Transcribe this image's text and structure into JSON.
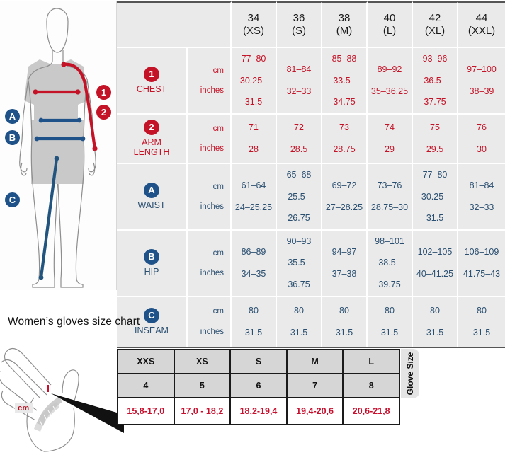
{
  "body_chart": {
    "header": {
      "corner_label": "",
      "sizes": [
        {
          "num": "34",
          "alpha": "(XS)"
        },
        {
          "num": "36",
          "alpha": "(S)"
        },
        {
          "num": "38",
          "alpha": "(M)"
        },
        {
          "num": "40",
          "alpha": "(L)"
        },
        {
          "num": "42",
          "alpha": "(XL)"
        },
        {
          "num": "44",
          "alpha": "(XXL)"
        }
      ]
    },
    "units": {
      "cm": "cm",
      "inches": "inches"
    },
    "rows": [
      {
        "badge": "1",
        "badge_color": "#c41226",
        "label": "CHEST",
        "color": "red",
        "cm": [
          "77–80",
          "81–84",
          "85–88",
          "89–92",
          "93–96",
          "97–100"
        ],
        "inches": [
          "30.25–31.5",
          "32–33",
          "33.5–34.75",
          "35–36.25",
          "36.5–37.75",
          "38–39"
        ]
      },
      {
        "badge": "2",
        "badge_color": "#c41226",
        "label": "ARM LENGTH",
        "color": "red",
        "cm": [
          "71",
          "72",
          "73",
          "74",
          "75",
          "76"
        ],
        "inches": [
          "28",
          "28.5",
          "28.75",
          "29",
          "29.5",
          "30"
        ]
      },
      {
        "badge": "A",
        "badge_color": "#1f5288",
        "label": "WAIST",
        "color": "blue",
        "cm": [
          "61–64",
          "65–68",
          "69–72",
          "73–76",
          "77–80",
          "81–84"
        ],
        "inches": [
          "24–25.25",
          "25.5–26.75",
          "27–28.25",
          "28.75–30",
          "30.25–31.5",
          "32–33"
        ]
      },
      {
        "badge": "B",
        "badge_color": "#1f5288",
        "label": "HIP",
        "color": "blue",
        "cm": [
          "86–89",
          "90–93",
          "94–97",
          "98–101",
          "102–105",
          "106–109"
        ],
        "inches": [
          "34–35",
          "35.5–36.75",
          "37–38",
          "38.5–39.75",
          "40–41.25",
          "41.75–43"
        ]
      },
      {
        "badge": "C",
        "badge_color": "#1f5288",
        "label": "INSEAM",
        "color": "blue",
        "cm": [
          "80",
          "80",
          "80",
          "80",
          "80",
          "80"
        ],
        "inches": [
          "31.5",
          "31.5",
          "31.5",
          "31.5",
          "31.5",
          "31.5"
        ]
      }
    ],
    "figure_markers": {
      "numbered": [
        {
          "id": "1",
          "meaning": "chest"
        },
        {
          "id": "2",
          "meaning": "arm-length"
        }
      ],
      "lettered": [
        {
          "id": "A",
          "meaning": "waist"
        },
        {
          "id": "B",
          "meaning": "hip"
        },
        {
          "id": "C",
          "meaning": "inseam"
        }
      ]
    }
  },
  "gloves_chart": {
    "title": "Women’s gloves size chart",
    "side_label": "Glove Size",
    "unit_tag": "cm",
    "letter_sizes": [
      "XXS",
      "XS",
      "S",
      "M",
      "L"
    ],
    "numeric_sizes": [
      "4",
      "5",
      "6",
      "7",
      "8"
    ],
    "measurements": [
      "15,8-17,0",
      "17,0 - 18,2",
      "18,2-19,4",
      "19,4-20,6",
      "20,6-21,8"
    ]
  },
  "colors": {
    "red": "#c41226",
    "blue": "#1f5288",
    "glove_red": "#c8102e",
    "cell_bg": "#eaeaea",
    "glove_header_bg": "#d6d6d6"
  }
}
